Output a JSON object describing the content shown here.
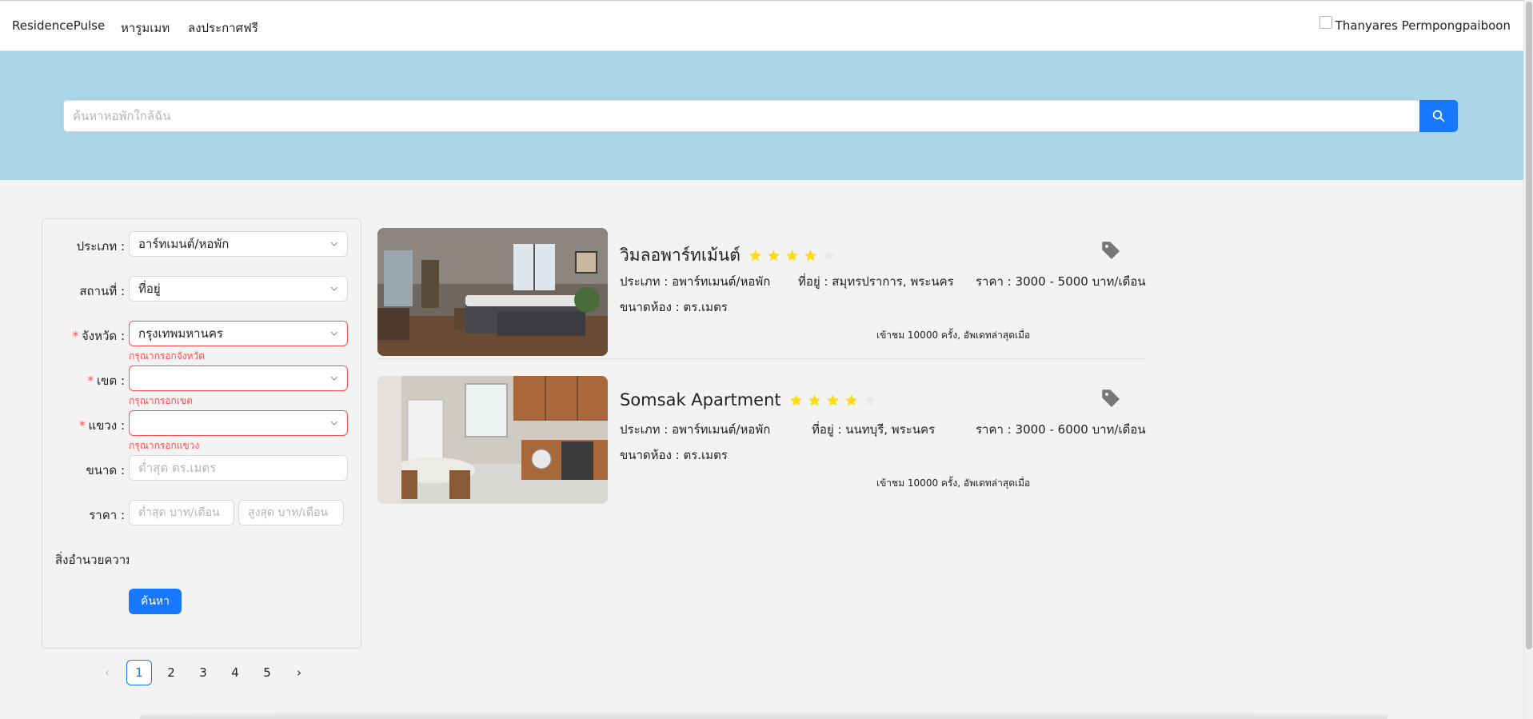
{
  "nav": {
    "brand": "ResidencePulse",
    "find_roommate": "หารูมเมท",
    "post_free": "ลงประกาศฟรี",
    "user_name": "Thanyares Permpongpaiboon"
  },
  "search": {
    "placeholder": "ค้นหาหอพักใกล้ฉัน",
    "value": ""
  },
  "filter": {
    "type_label": "ประเภท",
    "type_value": "อาร์ทเมนต์/หอพัก",
    "place_label": "สถานที่",
    "place_value": "ที่อยู่",
    "province_label": "จังหวัด",
    "province_value": "กรุงเทพมหานคร",
    "province_error": "กรุณากรอกจังหวัด",
    "district_label": "เขต",
    "district_value": "",
    "district_error": "กรุณากรอกเขต",
    "subdistrict_label": "แขวง",
    "subdistrict_value": "",
    "subdistrict_error": "กรุณากรอกแขวง",
    "size_label": "ขนาด",
    "size_placeholder": "ต่ำสุด ตร.เมตร",
    "price_label": "ราคา",
    "price_min_placeholder": "ต่ำสุด บาท/เดือน",
    "price_max_placeholder": "สูงสุด บาท/เดือน",
    "amenities_label": "สิ่งอำนวยความสะดวก",
    "submit_label": "ค้นหา"
  },
  "pagination": {
    "prev": "‹",
    "next": "›",
    "pages": [
      "1",
      "2",
      "3",
      "4",
      "5"
    ],
    "current": "1"
  },
  "listings": [
    {
      "title": "วิมลอพาร์ทเม้นต์",
      "rating": 4,
      "max_rating": 5,
      "type": "ประเภท : อพาร์ทเมนต์/หอพัก",
      "address": "ที่อยู่ : สมุทรปราการ, พระนคร",
      "price": "ราคา : 3000 - 5000 บาท/เดือน",
      "size": "ขนาดห้อง : ตร.เมตร",
      "views": "เข้าชม 10000 ครั้ง, อัพเดทล่าสุดเมื่อ",
      "image": "bedroom-photo"
    },
    {
      "title": "Somsak Apartment",
      "rating": 4,
      "max_rating": 5,
      "type": "ประเภท : อพาร์ทเมนต์/หอพัก",
      "address": "ที่อยู่ : นนทบุรี, พระนคร",
      "price": "ราคา : 3000 - 6000 บาท/เดือน",
      "size": "ขนาดห้อง : ตร.เมตร",
      "views": "เข้าชม 10000 ครั้ง, อัพเดทล่าสุดเมื่อ",
      "image": "kitchen-photo"
    }
  ],
  "colors": {
    "primary": "#1677ff",
    "hero": "#a9d5e6",
    "star": "#fadb14",
    "error": "#ff4d4f"
  }
}
